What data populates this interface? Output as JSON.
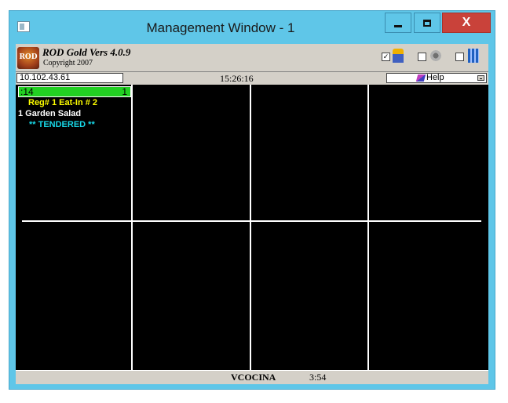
{
  "window": {
    "title": "Management Window - 1",
    "close_label": "X"
  },
  "toolbar": {
    "app_name": "ROD Gold Vers 4.0.9",
    "copyright": "Copyright 2007",
    "logo_text": "ROD",
    "check1": "✓",
    "icons": [
      "people-icon",
      "gear-icon",
      "grid-icon"
    ]
  },
  "status": {
    "ip": "10.102.43.61",
    "time": "15:26:16",
    "help_label": "Help"
  },
  "ticket": {
    "id": ":14",
    "count": "1",
    "reg_line": "Reg# 1 Eat-In # 2",
    "item_line": "1 Garden Salad",
    "status_line": "** TENDERED **"
  },
  "footer": {
    "station": "VCOCINA",
    "elapsed": "3:54"
  },
  "colors": {
    "titlebar": "#5fc6e8",
    "close_button": "#c9423a",
    "ticket_header": "#22d022",
    "reg_text": "#ffff00",
    "status_text": "#18d8e8"
  }
}
